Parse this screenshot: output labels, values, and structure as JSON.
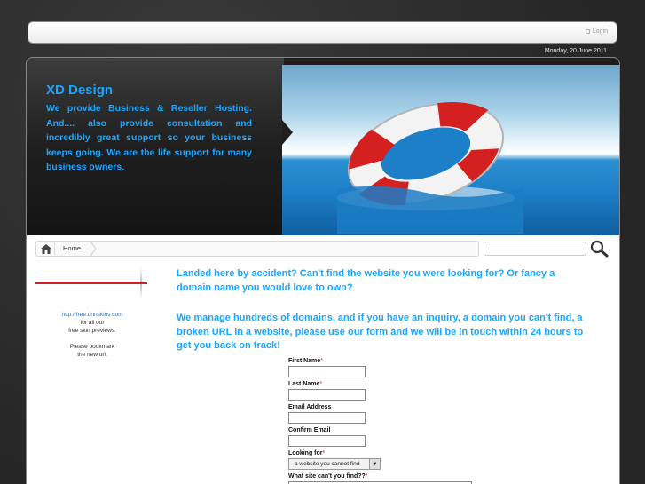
{
  "topbar": {
    "login_label": "Login"
  },
  "date": "Monday, 20 June 2011",
  "hero": {
    "title": "XD Design",
    "description": "We provide Business & Reseller Hosting. And.... also provide consultation and incredibly great support so your business keeps going. We are the life support for many business owners."
  },
  "breadcrumb": {
    "home_label": "Home"
  },
  "sidebar": {
    "link": "http://free.dnnskins.com",
    "line1": "for all our",
    "line2": "free skin previews.",
    "line3": "Please bookmark",
    "line4": "the new url."
  },
  "content": {
    "paragraph1": "Landed here by accident? Can't find the website you were looking for?  Or fancy a domain name you would love to own?",
    "paragraph2": "We manage hundreds of domains, and if you have an inquiry, a domain you can't find, a broken URL in a website, please use our form and we will be in touch within 24 hours to get you back on track!"
  },
  "form": {
    "first_name_label": "First Name",
    "last_name_label": "Last Name",
    "email_label": "Email Address",
    "confirm_email_label": "Confirm Email",
    "looking_for_label": "Looking for",
    "looking_for_value": "a website you cannot find",
    "what_site_label": "What site can't you find??",
    "required_mark": "*"
  },
  "colors": {
    "accent_blue": "#1aa6ff",
    "divider_red": "#cc2222"
  }
}
